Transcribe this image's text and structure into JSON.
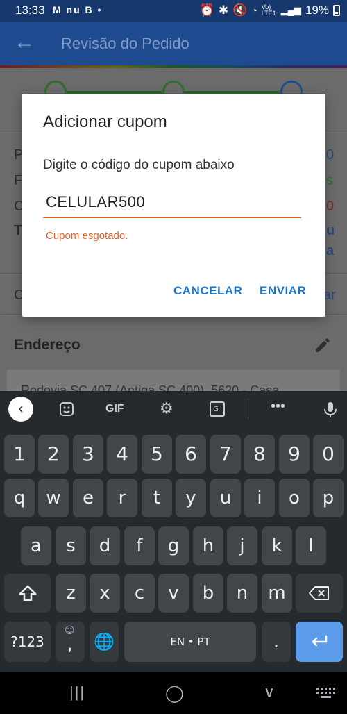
{
  "status_bar": {
    "time": "13:33",
    "left_icons": "M nu B •",
    "network": "Vo) LTE1",
    "battery": "19%"
  },
  "app_bar": {
    "back_icon": "arrow-left",
    "title": "Revisão do Pedido"
  },
  "background": {
    "section_title": "Endereço",
    "address_partial": "Rodovia SC 407 (Antiga SC 400), 5620 - Casa"
  },
  "dialog": {
    "title": "Adicionar cupom",
    "message": "Digite o código do cupom abaixo",
    "input_value": "CELULAR500",
    "error": "Cupom esgotado.",
    "cancel_label": "CANCELAR",
    "send_label": "ENVIAR",
    "accent_color": "#e0632b",
    "button_color": "#1a73c8"
  },
  "keyboard": {
    "toolbar": [
      "back",
      "sticker",
      "GIF",
      "settings",
      "translate",
      "more",
      "mic"
    ],
    "gif_label": "GIF",
    "more_label": "•••",
    "numbers": [
      "1",
      "2",
      "3",
      "4",
      "5",
      "6",
      "7",
      "8",
      "9",
      "0"
    ],
    "row1": [
      "q",
      "w",
      "e",
      "r",
      "t",
      "y",
      "u",
      "i",
      "o",
      "p"
    ],
    "row2": [
      "a",
      "s",
      "d",
      "f",
      "g",
      "h",
      "j",
      "k",
      "l"
    ],
    "row3": [
      "z",
      "x",
      "c",
      "v",
      "b",
      "n",
      "m"
    ],
    "symbols_label": "?123",
    "comma_label": ",",
    "space_label": "EN • PT",
    "period_label": "."
  },
  "nav_bar": {
    "recents": "|||",
    "home": "◯",
    "back": "∨"
  }
}
